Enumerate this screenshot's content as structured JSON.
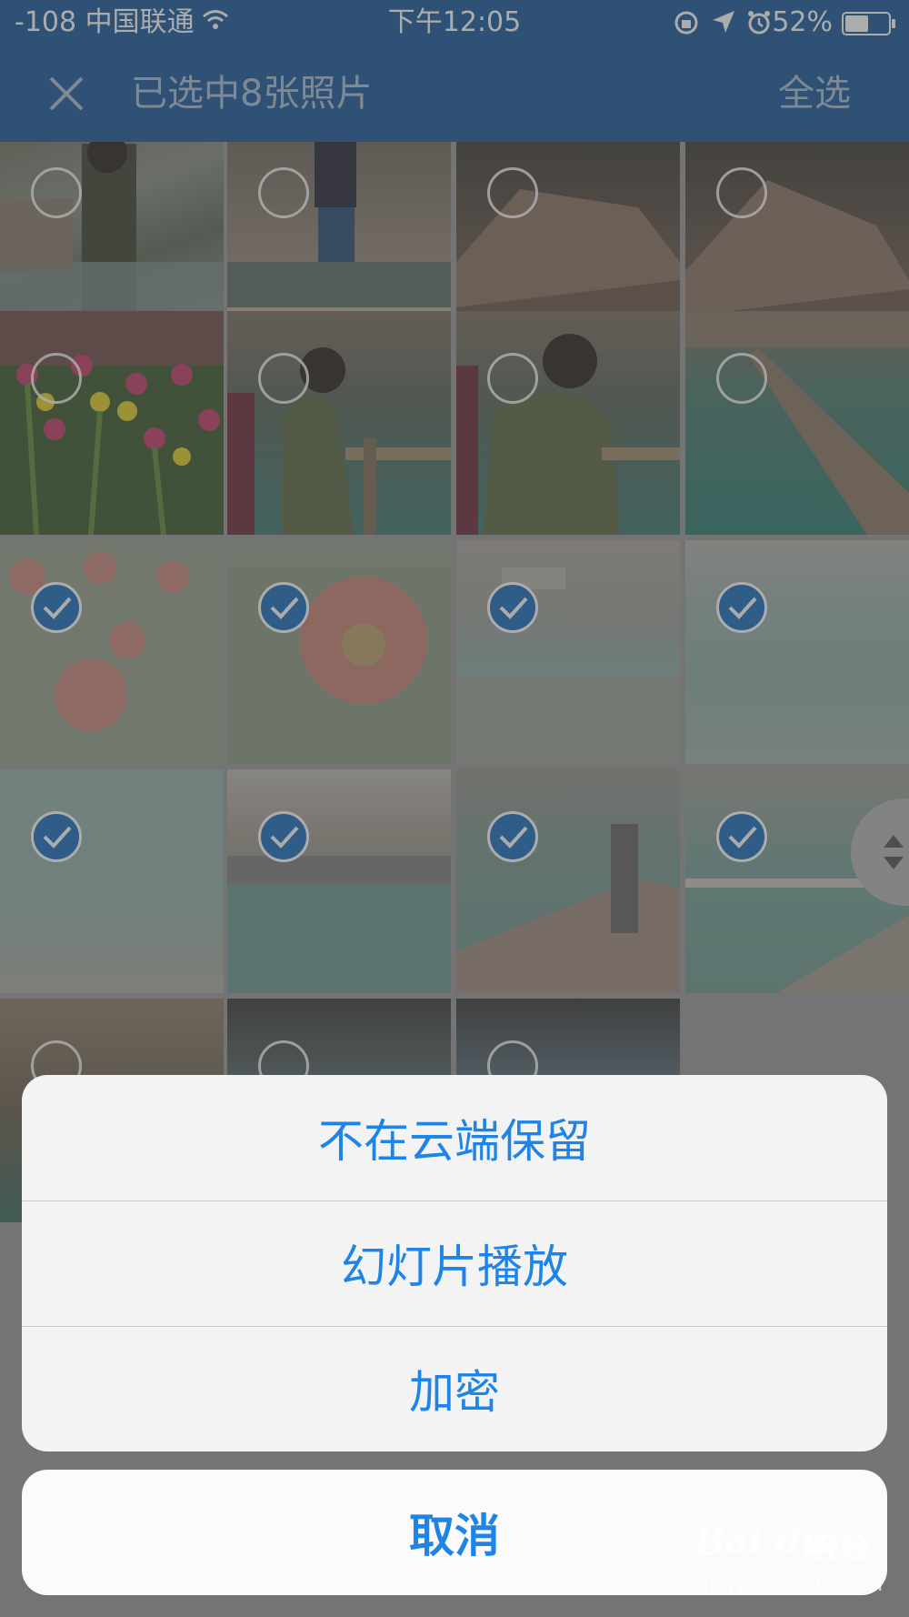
{
  "status_bar": {
    "carrier": "-108 中国联通",
    "time": "下午12:05",
    "battery_percent": "52%",
    "icons": [
      "wifi-icon",
      "rotation-lock-icon",
      "location-arrow-icon",
      "alarm-icon",
      "battery-icon"
    ]
  },
  "nav": {
    "close_icon": "close-icon",
    "title": "已选中8张照片",
    "select_all": "全选"
  },
  "grid": {
    "selected_count": 8,
    "tiles_selected": [
      false,
      false,
      false,
      false,
      false,
      false,
      false,
      false,
      true,
      true,
      true,
      true,
      true,
      true,
      true,
      true,
      false,
      false,
      false
    ]
  },
  "action_sheet": {
    "items": [
      "不在云端保留",
      "幻灯片播放",
      "加密"
    ],
    "cancel": "取消"
  },
  "watermark": {
    "logo": "Bai du",
    "word": "经验",
    "url": "jingyan.baidu.com"
  },
  "colors": {
    "nav_bar": "#1a5a9c",
    "action_text": "#1f84e8",
    "check_fill": "#1e6fbd"
  }
}
